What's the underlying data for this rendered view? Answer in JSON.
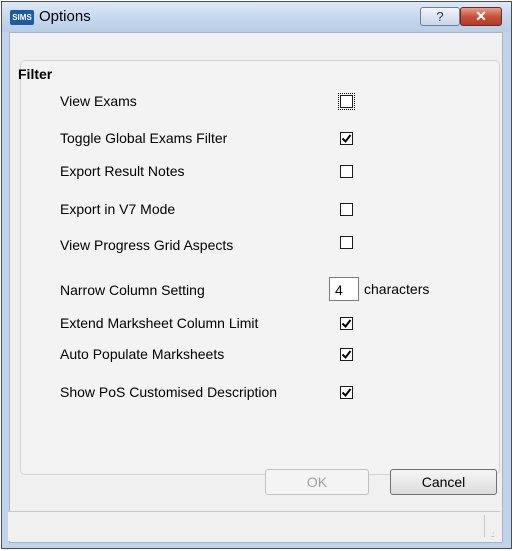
{
  "window": {
    "icon_text": "SIMS",
    "title": "Options",
    "help_label": "?",
    "close_label": "✕"
  },
  "filter": {
    "title": "Filter",
    "options": [
      {
        "label": "View Exams",
        "checked": false,
        "focused": true
      },
      {
        "label": "Toggle Global Exams Filter",
        "checked": true
      },
      {
        "label": "Export Result Notes",
        "checked": false
      },
      {
        "label": "Export in V7 Mode",
        "checked": false
      },
      {
        "label": "View Progress Grid Aspects",
        "checked": false
      }
    ],
    "narrow_column": {
      "label": "Narrow Column Setting",
      "value": "4",
      "suffix": "characters"
    },
    "options2": [
      {
        "label": "Extend Marksheet Column Limit",
        "checked": true
      },
      {
        "label": "Auto Populate Marksheets",
        "checked": true
      },
      {
        "label": "Show PoS Customised Description",
        "checked": true
      }
    ]
  },
  "buttons": {
    "ok": "OK",
    "cancel": "Cancel"
  },
  "colors": {
    "title_bar": "#c6d8ee",
    "close_button": "#c7523b",
    "dialog_bg": "#f0f0f0"
  }
}
